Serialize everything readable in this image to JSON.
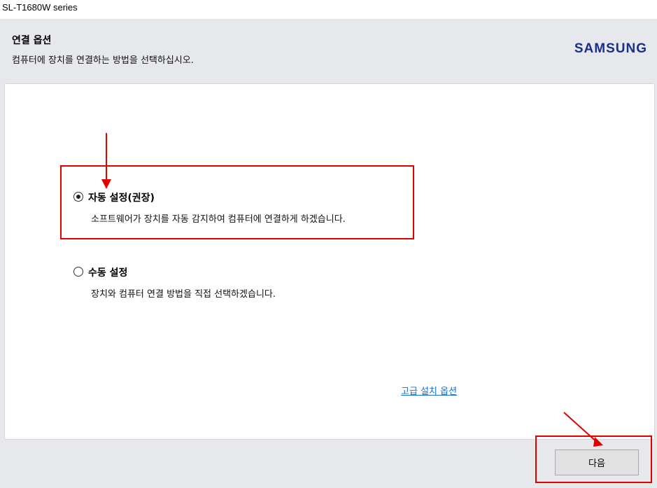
{
  "window": {
    "title": "SL-T1680W series"
  },
  "header": {
    "title": "연결 옵션",
    "subtitle": "컴퓨터에 장치를 연결하는 방법을 선택하십시오.",
    "logo_text": "SAMSUNG"
  },
  "options": [
    {
      "label": "자동 설정(권장)",
      "description": "소프트웨어가 장치를 자동 감지하여 컴퓨터에 연결하게 하겠습니다.",
      "selected": true
    },
    {
      "label": "수동 설정",
      "description": "장치와 컴퓨터 연결 방법을 직접 선택하겠습니다.",
      "selected": false
    }
  ],
  "advanced_link": "고급 설치 옵션",
  "footer": {
    "next_label": "다음"
  },
  "colors": {
    "annotation_red": "#e00000",
    "brand_blue": "#1a2f8c",
    "link_blue": "#1a6fd1"
  }
}
